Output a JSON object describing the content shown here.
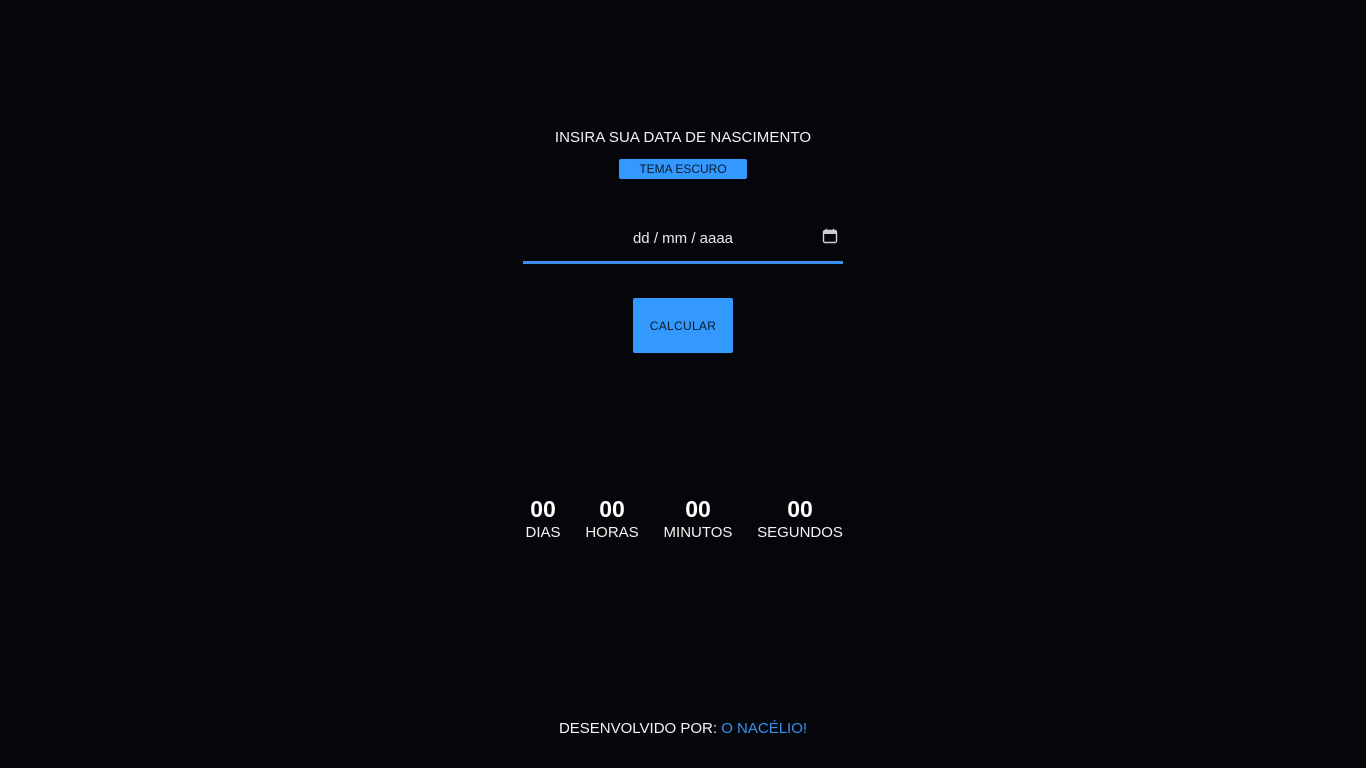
{
  "header": {
    "title": "INSIRA SUA DATA DE NASCIMENTO",
    "theme_button_label": "TEMA ESCURO"
  },
  "form": {
    "date_placeholder": "dd / mm / aaaa",
    "date_value": "",
    "calendar_icon": "calendar-icon",
    "calculate_label": "CALCULAR"
  },
  "counter": {
    "days": {
      "value": "00",
      "label": "DIAS"
    },
    "hours": {
      "value": "00",
      "label": "HORAS"
    },
    "minutes": {
      "value": "00",
      "label": "MINUTOS"
    },
    "seconds": {
      "value": "00",
      "label": "SEGUNDOS"
    }
  },
  "footer": {
    "prefix": "DESENVOLVIDO POR:",
    "author": "O NACÉLIO!"
  },
  "colors": {
    "background": "#05060a",
    "accent": "#3399ff",
    "link": "#3a8ff0",
    "text": "#ffffff"
  }
}
